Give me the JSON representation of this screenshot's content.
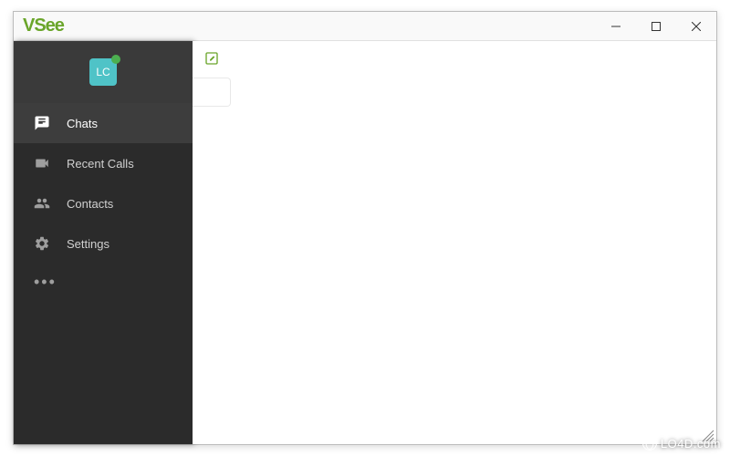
{
  "app": {
    "title": "VSee"
  },
  "profile": {
    "initials": "LC",
    "presence": "online"
  },
  "sidebar": {
    "items": [
      {
        "label": "Chats"
      },
      {
        "label": "Recent Calls"
      },
      {
        "label": "Contacts"
      },
      {
        "label": "Settings"
      }
    ]
  },
  "watermark": {
    "text": "LO4D.com"
  }
}
